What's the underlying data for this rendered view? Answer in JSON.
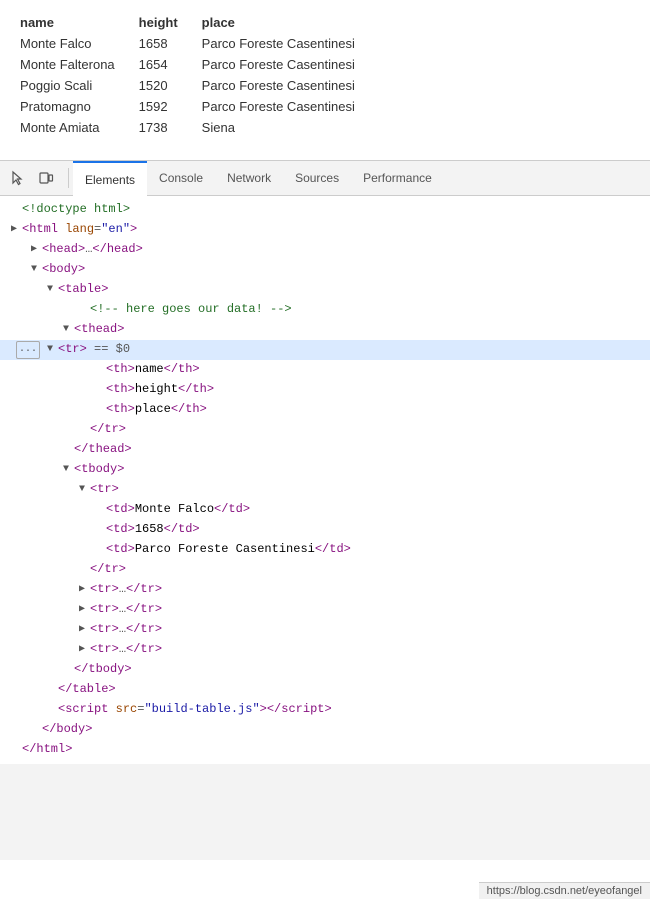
{
  "preview": {
    "table": {
      "headers": [
        "name",
        "height",
        "place"
      ],
      "rows": [
        [
          "Monte Falco",
          "1658",
          "Parco Foreste Casentinesi"
        ],
        [
          "Monte Falterona",
          "1654",
          "Parco Foreste Casentinesi"
        ],
        [
          "Poggio Scali",
          "1520",
          "Parco Foreste Casentinesi"
        ],
        [
          "Pratomagno",
          "1592",
          "Parco Foreste Casentinesi"
        ],
        [
          "Monte Amiata",
          "1738",
          "Siena"
        ]
      ]
    }
  },
  "devtools": {
    "tabs": [
      "Elements",
      "Console",
      "Network",
      "Sources",
      "Performance"
    ],
    "active_tab": "Elements"
  },
  "icons": {
    "cursor": "⬚",
    "device": "▭"
  },
  "code": {
    "lines": [
      "<!doctype html>",
      "<html lang=\"en\">",
      "<head>…</head>",
      "<body>",
      "  <table>",
      "    <!-- here goes our data! -->",
      "    <thead>",
      "      <tr> == $0",
      "        <th>name</th>",
      "        <th>height</th>",
      "        <th>place</th>",
      "      </tr>",
      "    </thead>",
      "    <tbody>",
      "      <tr>",
      "        <td>Monte Falco</td>",
      "        <td>1658</td>",
      "        <td>Parco Foreste Casentinesi</td>",
      "      </tr>",
      "      <tr>…</tr>",
      "      <tr>…</tr>",
      "      <tr>…</tr>",
      "      <tr>…</tr>",
      "    </tbody>",
      "  </table>",
      "  <script src=\"build-table.js\"></scr ipt>",
      "</body>",
      "</html>"
    ]
  },
  "url": "https://blog.csdn.net/eyeofangel"
}
